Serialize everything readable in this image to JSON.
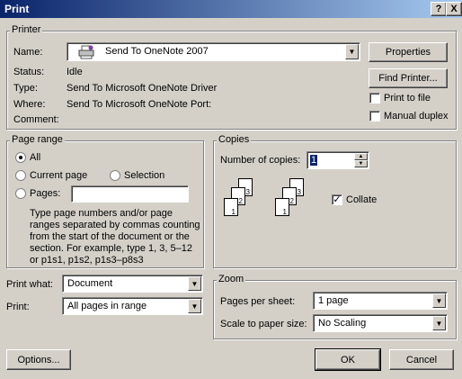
{
  "window": {
    "title": "Print",
    "help_glyph": "?",
    "close_glyph": "X"
  },
  "printer": {
    "legend": "Printer",
    "name_label": "Name:",
    "name_value": "Send To OneNote 2007",
    "status_label": "Status:",
    "status_value": "Idle",
    "type_label": "Type:",
    "type_value": "Send To Microsoft OneNote Driver",
    "where_label": "Where:",
    "where_value": "Send To Microsoft OneNote Port:",
    "comment_label": "Comment:",
    "comment_value": "",
    "properties_button": "Properties",
    "find_printer_button": "Find Printer...",
    "print_to_file_label": "Print to file",
    "print_to_file_checked": false,
    "manual_duplex_label": "Manual duplex",
    "manual_duplex_checked": false
  },
  "page_range": {
    "legend": "Page range",
    "all_label": "All",
    "current_page_label": "Current page",
    "selection_label": "Selection",
    "pages_label": "Pages:",
    "pages_value": "",
    "selected": "All",
    "hint_line1": "Type page numbers and/or page",
    "hint_line2": "ranges separated by commas counting",
    "hint_line3": "from the start of the document or the",
    "hint_line4": "section. For example, type 1, 3, 5–12",
    "hint_line5": "or p1s1, p1s2, p1s3–p8s3"
  },
  "copies": {
    "legend": "Copies",
    "number_label": "Number of copies:",
    "number_value": "1",
    "collate_label": "Collate",
    "collate_checked": true,
    "page_nums": [
      "1",
      "2",
      "3"
    ]
  },
  "print_what": {
    "label": "Print what:",
    "value": "Document"
  },
  "print": {
    "label": "Print:",
    "value": "All pages in range"
  },
  "zoom": {
    "legend": "Zoom",
    "pages_per_sheet_label": "Pages per sheet:",
    "pages_per_sheet_value": "1 page",
    "scale_label": "Scale to paper size:",
    "scale_value": "No Scaling"
  },
  "buttons": {
    "options": "Options...",
    "ok": "OK",
    "cancel": "Cancel"
  },
  "icons": {
    "printer": "printer-icon",
    "dropdown": "chevron-down-icon"
  }
}
